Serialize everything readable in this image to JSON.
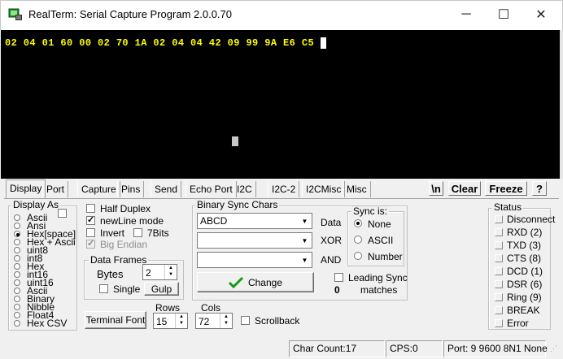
{
  "window": {
    "title": "RealTerm: Serial Capture Program 2.0.0.70",
    "min_glyph": "─",
    "max_glyph": "☐",
    "close_glyph": "✕"
  },
  "terminal": {
    "text": "02 04 01 60 00 02 70 1A 02 04 04 42 09 99 9A E6 C5 ",
    "text_color": "#ffff00",
    "bg_color": "#000000"
  },
  "tabs": [
    "Display",
    "Port",
    "Capture",
    "Pins",
    "Send",
    "Echo Port",
    "I2C",
    "I2C-2",
    "I2CMisc",
    "Misc"
  ],
  "hot_buttons": {
    "newline": "\\n",
    "clear": "Clear",
    "freeze": "Freeze",
    "help": "?"
  },
  "display_as": {
    "label": "Display As",
    "options": [
      "Ascii",
      "Ansi",
      "Hex[space]",
      "Hex + Ascii",
      "uint8",
      "int8",
      "Hex",
      "int16",
      "uint16",
      "Ascii",
      "Binary",
      "Nibble",
      "Float4",
      "Hex CSV"
    ],
    "selected_index": 2
  },
  "options": {
    "half_duplex": "Half Duplex",
    "newline_mode": "newLine mode",
    "invert": "Invert",
    "seven_bits": "7Bits",
    "big_endian": "Big Endian"
  },
  "data_frames": {
    "label": "Data Frames",
    "bytes_label": "Bytes",
    "bytes_value": "2",
    "single_label": "Single",
    "gulp_label": "Gulp"
  },
  "terminal_font_label": "Terminal Font",
  "rows": {
    "label": "Rows",
    "value": "15"
  },
  "cols": {
    "label": "Cols",
    "value": "72"
  },
  "scrollback_label": "Scrollback",
  "binary_sync": {
    "label": "Binary Sync Chars",
    "data_value": "ABCD",
    "data_label": "Data",
    "xor_label": "XOR",
    "and_label": "AND",
    "change_label": "Change",
    "sync_is_label": "Sync is:",
    "sync_options": [
      "None",
      "ASCII",
      "Number"
    ],
    "sync_selected_index": 0,
    "leading_sync_label": "Leading Sync",
    "matches_count": "0",
    "matches_label": "matches"
  },
  "status": {
    "label": "Status",
    "items": [
      "Disconnect",
      "RXD (2)",
      "TXD (3)",
      "CTS (8)",
      "DCD (1)",
      "DSR (6)",
      "Ring (9)",
      "BREAK",
      "Error"
    ]
  },
  "statusbar": {
    "char_count": "Char Count:17",
    "cps": "CPS:0",
    "port": "Port: 9 9600 8N1 None"
  }
}
